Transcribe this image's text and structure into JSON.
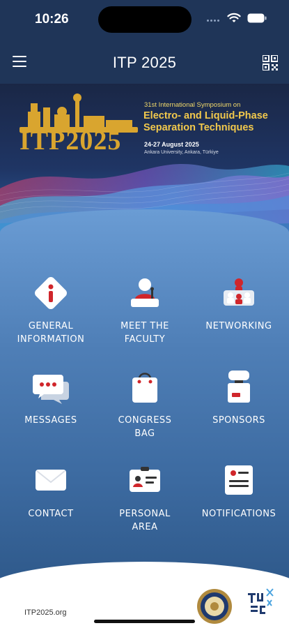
{
  "status": {
    "time": "10:26"
  },
  "header": {
    "title": "ITP 2025"
  },
  "banner": {
    "subtitle": "31st International Symposium on",
    "headline_line1": "Electro- and Liquid-Phase",
    "headline_line2": "Separation Techniques",
    "dates": "24-27 August 2025",
    "venue": "Ankara University, Ankara, Türkiye",
    "logo_text": "ITP2025",
    "colors": {
      "gold": "#d9a52f",
      "headline": "#f2c94c",
      "navy": "#1b2a4a"
    }
  },
  "tiles": [
    {
      "label_line1": "GENERAL",
      "label_line2": "INFORMATION",
      "icon": "info-icon"
    },
    {
      "label_line1": "MEET THE",
      "label_line2": "FACULTY",
      "icon": "speaker-icon"
    },
    {
      "label_line1": "NETWORKING",
      "label_line2": "",
      "icon": "networking-icon"
    },
    {
      "label_line1": "MESSAGES",
      "label_line2": "",
      "icon": "chat-icon"
    },
    {
      "label_line1": "CONGRESS",
      "label_line2": "BAG",
      "icon": "bag-icon"
    },
    {
      "label_line1": "SPONSORS",
      "label_line2": "",
      "icon": "sponsor-booth-icon"
    },
    {
      "label_line1": "CONTACT",
      "label_line2": "",
      "icon": "envelope-icon"
    },
    {
      "label_line1": "PERSONAL",
      "label_line2": "AREA",
      "icon": "id-card-icon"
    },
    {
      "label_line1": "NOTIFICATIONS",
      "label_line2": "",
      "icon": "notification-board-icon"
    }
  ],
  "footer": {
    "url": "ITP2025.org"
  },
  "colors": {
    "header_bg": "#1f3558",
    "panel_top": "#6a9cd4",
    "panel_bottom": "#2d5788",
    "accent_red": "#d0262b"
  }
}
